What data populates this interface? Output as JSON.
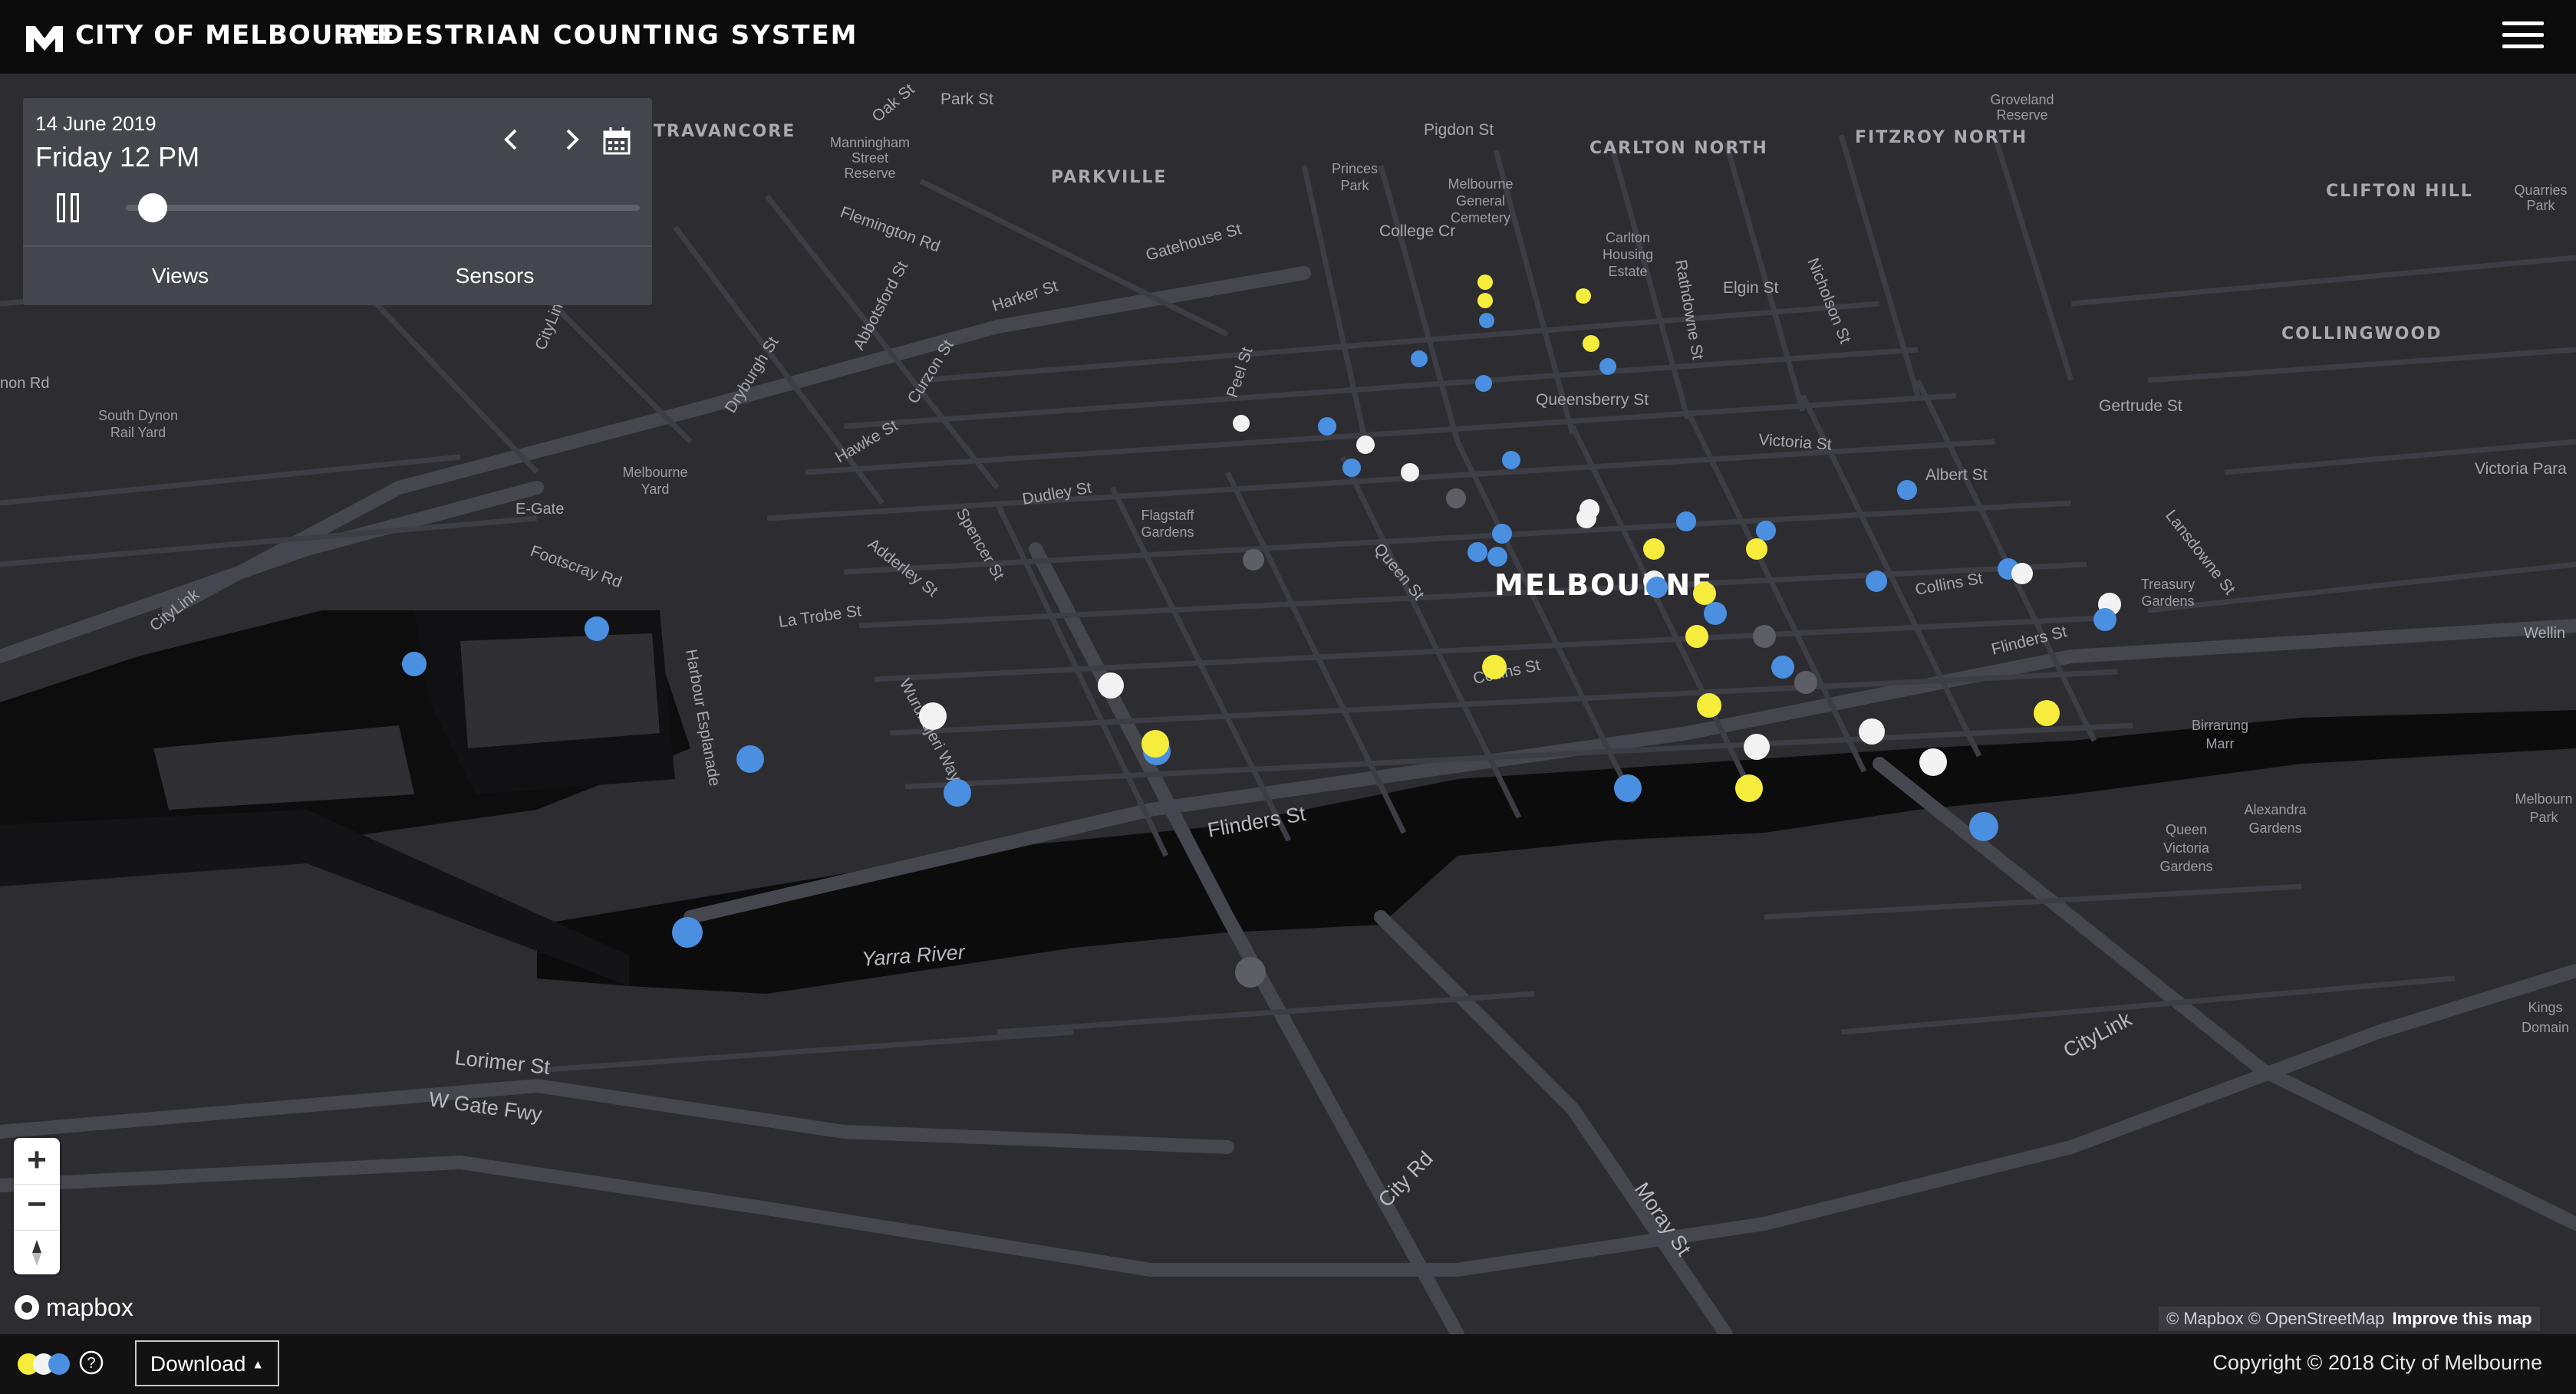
{
  "header": {
    "brand": "CITY OF MELBOURNE",
    "system_title": "PEDESTRIAN COUNTING SYSTEM",
    "menu_icon": "hamburger-icon"
  },
  "controls": {
    "date": "14 June 2019",
    "day_time": "Friday 12 PM",
    "prev_icon": "chevron-left-icon",
    "next_icon": "chevron-right-icon",
    "calendar_icon": "calendar-icon",
    "play_state_icon": "pause-icon",
    "slider_value_fraction": 0.01,
    "tabs": [
      "Views",
      "Sensors"
    ]
  },
  "map": {
    "place_labels": {
      "travancore": "TRAVANCORE",
      "parkville": "PARKVILLE",
      "carlton_north": "CARLTON NORTH",
      "fitzroy_north": "FITZROY NORTH",
      "clifton_hill": "CLIFTON HILL",
      "collingwood": "COLLINGWOOD",
      "melbourne": "MELBOURNE"
    },
    "park_labels": {
      "manningham": [
        "Manningham",
        "Street",
        "Reserve"
      ],
      "princes_park": [
        "Princes",
        "Park"
      ],
      "general_cemetery": [
        "Melbourne",
        "General",
        "Cemetery"
      ],
      "carlton_housing": [
        "Carlton",
        "Housing",
        "Estate"
      ],
      "groveland": [
        "Groveland",
        "Reserve"
      ],
      "quarries_park": [
        "Quarries",
        "Park"
      ],
      "south_dynon": [
        "South Dynon",
        "Rail Yard"
      ],
      "melbourne_yard": [
        "Melbourne",
        "Yard"
      ],
      "flagstaff": [
        "Flagstaff",
        "Gardens"
      ],
      "treasury": [
        "Treasury",
        "Gardens"
      ],
      "birrarung": [
        "Birrarung",
        "Marr"
      ],
      "alexandra": [
        "Alexandra",
        "Gardens"
      ],
      "queen_victoria": [
        "Queen",
        "Victoria",
        "Gardens"
      ],
      "melbourne_park": [
        "Melbourn",
        "Park"
      ],
      "kings_domain": [
        "Kings",
        "Domain"
      ],
      "e_gate": "E-Gate"
    },
    "street_labels": {
      "oak_st": "Oak St",
      "park_st": "Park St",
      "pigdon_st": "Pigdon St",
      "flemington_rd": "Flemington Rd",
      "gatehouse_st": "Gatehouse St",
      "college_cr": "College Cr",
      "harker_st": "Harker St",
      "abbotsford_st": "Abbotsford St",
      "citylink_north": "CityLink",
      "dryburgh_st": "Dryburgh St",
      "curzon_st": "Curzon St",
      "peel_st": "Peel St",
      "rathdowne_st": "Rathdowne St",
      "elgin_st": "Elgin St",
      "nicholson_st": "Nicholson St",
      "queensberry_st": "Queensberry St",
      "gertrude_st": "Gertrude St",
      "victoria_st": "Victoria St",
      "victoria_parade": "Victoria Para",
      "albert_st": "Albert St",
      "lansdowne_st": "Lansdowne St",
      "hawke_st": "Hawke St",
      "dudley_st": "Dudley St",
      "adderley_st": "Adderley St",
      "spencer_st": "Spencer St",
      "queen_st": "Queen St",
      "collins_st_east": "Collins St",
      "collins_st": "Collins St",
      "flinders_st_east": "Flinders St",
      "footscray_rd": "Footscray Rd",
      "la_trobe_st": "La Trobe St",
      "citylink_west": "CityLink",
      "harbour_esplanade": "Harbour Esplanade",
      "wurundjeri_way": "Wurundjeri Way",
      "flinders_st": "Flinders St",
      "yarra_river": "Yarra River",
      "lorimer_st": "Lorimer St",
      "w_gate_fwy": "W Gate Fwy",
      "city_rd": "City Rd",
      "moray_st": "Moray St",
      "citylink_east": "CityLink",
      "wellin": "Wellin",
      "dynon_rd": "non Rd"
    },
    "sensor_colors": {
      "yellow": "#f5ec3c",
      "blue": "#4a8fe0",
      "white": "#f2f2f2",
      "grey": "#5e5f66"
    }
  },
  "map_controls": {
    "zoom_in": "+",
    "zoom_out": "−",
    "compass_icon": "compass-icon",
    "mapbox_logo": "mapbox",
    "attribution": "© Mapbox © OpenStreetMap",
    "improve_link": "Improve this map"
  },
  "footer": {
    "legend_icon": "legend-toggle-icon",
    "help_icon": "help-icon",
    "download_label": "Download",
    "download_caret_icon": "caret-up-icon",
    "copyright": "Copyright © 2018 City of Melbourne"
  }
}
